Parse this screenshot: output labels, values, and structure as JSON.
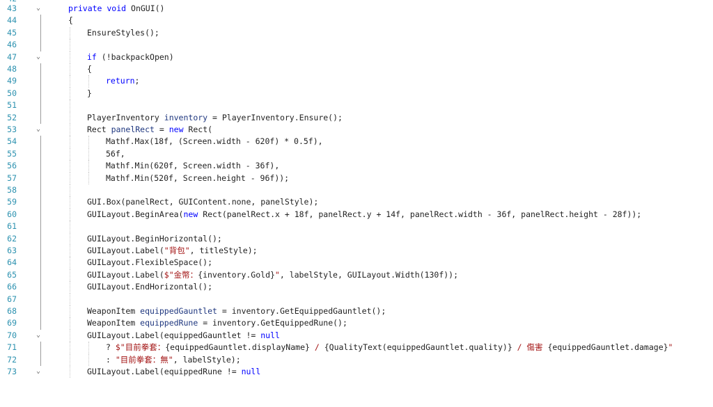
{
  "editor": {
    "top_partial_line_number": "42",
    "lines": [
      {
        "n": "43",
        "fold": true,
        "indent": 0,
        "tokens": [
          {
            "t": "private void",
            "c": "kw"
          },
          {
            "t": " OnGUI()"
          }
        ]
      },
      {
        "n": "44",
        "indent": 0,
        "tokens": [
          {
            "t": "{"
          }
        ]
      },
      {
        "n": "45",
        "indent": 1,
        "tokens": [
          {
            "t": "EnsureStyles();"
          }
        ]
      },
      {
        "n": "46",
        "indent": 1,
        "tokens": []
      },
      {
        "n": "47",
        "fold": true,
        "indent": 1,
        "tokens": [
          {
            "t": "if",
            "c": "kw"
          },
          {
            "t": " (!backpackOpen)"
          }
        ]
      },
      {
        "n": "48",
        "indent": 1,
        "tokens": [
          {
            "t": "{"
          }
        ]
      },
      {
        "n": "49",
        "indent": 2,
        "tokens": [
          {
            "t": "return",
            "c": "kw"
          },
          {
            "t": ";"
          }
        ]
      },
      {
        "n": "50",
        "indent": 1,
        "tokens": [
          {
            "t": "}"
          }
        ]
      },
      {
        "n": "51",
        "indent": 1,
        "tokens": []
      },
      {
        "n": "52",
        "indent": 1,
        "tokens": [
          {
            "t": "PlayerInventory "
          },
          {
            "t": "inventory",
            "c": "prop"
          },
          {
            "t": " = PlayerInventory.Ensure();"
          }
        ]
      },
      {
        "n": "53",
        "fold": true,
        "indent": 1,
        "tokens": [
          {
            "t": "Rect "
          },
          {
            "t": "panelRect",
            "c": "prop"
          },
          {
            "t": " = "
          },
          {
            "t": "new",
            "c": "kw"
          },
          {
            "t": " Rect("
          }
        ]
      },
      {
        "n": "54",
        "indent": 2,
        "tokens": [
          {
            "t": "Mathf.Max(18f, (Screen.width - 620f) * 0.5f),"
          }
        ]
      },
      {
        "n": "55",
        "indent": 2,
        "tokens": [
          {
            "t": "56f,"
          }
        ]
      },
      {
        "n": "56",
        "indent": 2,
        "tokens": [
          {
            "t": "Mathf.Min(620f, Screen.width - 36f),"
          }
        ]
      },
      {
        "n": "57",
        "indent": 2,
        "tokens": [
          {
            "t": "Mathf.Min(520f, Screen.height - 96f));"
          }
        ]
      },
      {
        "n": "58",
        "indent": 1,
        "tokens": []
      },
      {
        "n": "59",
        "indent": 1,
        "tokens": [
          {
            "t": "GUI.Box(panelRect, GUIContent.none, panelStyle);"
          }
        ]
      },
      {
        "n": "60",
        "indent": 1,
        "tokens": [
          {
            "t": "GUILayout.BeginArea("
          },
          {
            "t": "new",
            "c": "kw"
          },
          {
            "t": " Rect(panelRect.x + 18f, panelRect.y + 14f, panelRect.width - 36f, panelRect.height - 28f));"
          }
        ]
      },
      {
        "n": "61",
        "indent": 1,
        "tokens": []
      },
      {
        "n": "62",
        "indent": 1,
        "tokens": [
          {
            "t": "GUILayout.BeginHorizontal();"
          }
        ]
      },
      {
        "n": "63",
        "indent": 1,
        "tokens": [
          {
            "t": "GUILayout.Label("
          },
          {
            "t": "\"背包\"",
            "c": "str"
          },
          {
            "t": ", titleStyle);"
          }
        ]
      },
      {
        "n": "64",
        "indent": 1,
        "tokens": [
          {
            "t": "GUILayout.FlexibleSpace();"
          }
        ]
      },
      {
        "n": "65",
        "indent": 1,
        "tokens": [
          {
            "t": "GUILayout.Label("
          },
          {
            "t": "$\"金幣：",
            "c": "str"
          },
          {
            "t": "{inventory.Gold}"
          },
          {
            "t": "\"",
            "c": "str"
          },
          {
            "t": ", labelStyle, GUILayout.Width(130f));"
          }
        ]
      },
      {
        "n": "66",
        "indent": 1,
        "tokens": [
          {
            "t": "GUILayout.EndHorizontal();"
          }
        ]
      },
      {
        "n": "67",
        "indent": 1,
        "tokens": []
      },
      {
        "n": "68",
        "indent": 1,
        "tokens": [
          {
            "t": "WeaponItem "
          },
          {
            "t": "equippedGauntlet",
            "c": "prop"
          },
          {
            "t": " = inventory.GetEquippedGauntlet();"
          }
        ]
      },
      {
        "n": "69",
        "indent": 1,
        "tokens": [
          {
            "t": "WeaponItem "
          },
          {
            "t": "equippedRune",
            "c": "prop"
          },
          {
            "t": " = inventory.GetEquippedRune();"
          }
        ]
      },
      {
        "n": "70",
        "fold": true,
        "indent": 1,
        "tokens": [
          {
            "t": "GUILayout.Label(equippedGauntlet != "
          },
          {
            "t": "null",
            "c": "kw"
          }
        ]
      },
      {
        "n": "71",
        "indent": 2,
        "tokens": [
          {
            "t": "? "
          },
          {
            "t": "$\"目前拳套：",
            "c": "str"
          },
          {
            "t": "{equippedGauntlet.displayName}"
          },
          {
            "t": " / ",
            "c": "str"
          },
          {
            "t": "{QualityText(equippedGauntlet.quality)}"
          },
          {
            "t": " / 傷害 ",
            "c": "str"
          },
          {
            "t": "{equippedGauntlet.damage}"
          },
          {
            "t": "\"",
            "c": "str"
          }
        ]
      },
      {
        "n": "72",
        "indent": 2,
        "tokens": [
          {
            "t": ": "
          },
          {
            "t": "\"目前拳套：無\"",
            "c": "str"
          },
          {
            "t": ", labelStyle);"
          }
        ]
      },
      {
        "n": "73",
        "fold": true,
        "indent": 1,
        "tokens": [
          {
            "t": "GUILayout.Label(equippedRune != "
          },
          {
            "t": "null",
            "c": "kw"
          }
        ]
      }
    ]
  }
}
